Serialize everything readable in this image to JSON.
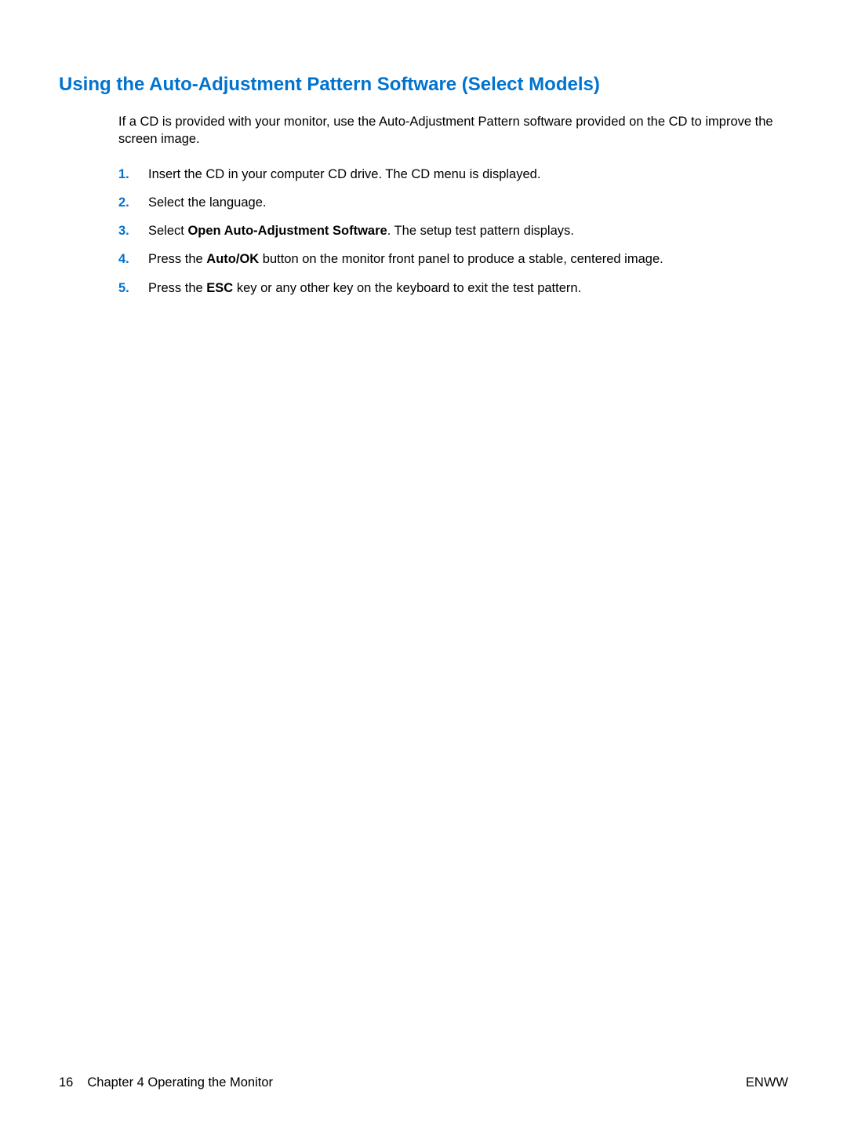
{
  "heading": "Using the Auto-Adjustment Pattern Software (Select Models)",
  "intro": "If a CD is provided with your monitor, use the Auto-Adjustment Pattern software provided on the CD to improve the screen image.",
  "steps": [
    {
      "number": "1.",
      "parts": [
        {
          "text": "Insert the CD in your computer CD drive. The CD menu is displayed.",
          "bold": false
        }
      ]
    },
    {
      "number": "2.",
      "parts": [
        {
          "text": "Select the language.",
          "bold": false
        }
      ]
    },
    {
      "number": "3.",
      "parts": [
        {
          "text": "Select ",
          "bold": false
        },
        {
          "text": "Open Auto-Adjustment Software",
          "bold": true
        },
        {
          "text": ". The setup test pattern displays.",
          "bold": false
        }
      ]
    },
    {
      "number": "4.",
      "parts": [
        {
          "text": "Press the ",
          "bold": false
        },
        {
          "text": "Auto/OK",
          "bold": true
        },
        {
          "text": " button on the monitor front panel to produce a stable, centered image.",
          "bold": false
        }
      ]
    },
    {
      "number": "5.",
      "parts": [
        {
          "text": "Press the ",
          "bold": false
        },
        {
          "text": "ESC",
          "bold": true
        },
        {
          "text": " key or any other key on the keyboard to exit the test pattern.",
          "bold": false
        }
      ]
    }
  ],
  "footer": {
    "page_number": "16",
    "chapter": "Chapter 4   Operating the Monitor",
    "right": "ENWW"
  }
}
